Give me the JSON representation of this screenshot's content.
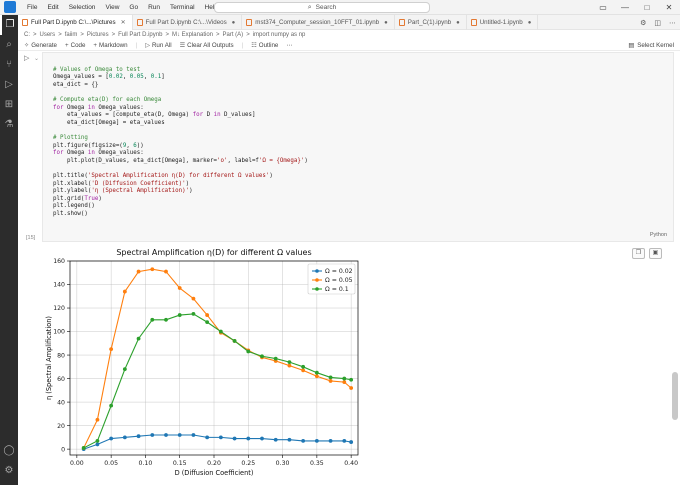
{
  "menu": [
    "File",
    "Edit",
    "Selection",
    "View",
    "Go",
    "Run",
    "Terminal",
    "Help"
  ],
  "search": {
    "placeholder": "Search"
  },
  "tabs": [
    {
      "label": "Full Part D.ipynb  C:\\...\\Pictures",
      "active": true
    },
    {
      "label": "Full Part D.ipynb  C:\\...\\Videos",
      "active": false
    },
    {
      "label": "mst374_Computer_session_10FFT_01.ipynb",
      "active": false
    },
    {
      "label": "Part_C(1).ipynb",
      "active": false
    },
    {
      "label": "Untitled-1.ipynb",
      "active": false
    }
  ],
  "breadcrumb": [
    "C:",
    ">",
    "Users",
    ">",
    "faiim",
    ">",
    "Pictures",
    ">",
    "Full Part D.ipynb",
    ">",
    "M↓ Explanation",
    ">",
    "Part (A)",
    ">",
    "import numpy as np"
  ],
  "toolbar": {
    "generate": "Generate",
    "code": "Code",
    "markdown": "Markdown",
    "run_all": "Run All",
    "clear_outputs": "Clear All Outputs",
    "outline": "Outline",
    "kernel": "Select Kernel"
  },
  "cell": {
    "run_icon": "play-icon",
    "language": "Python",
    "exec_count": "[15]",
    "lines": [
      [
        [
          "",
          "    "
        ]
      ],
      [
        [
          "c-com",
          "# Values of Omega to test"
        ]
      ],
      [
        [
          "",
          "Omega_values = ["
        ],
        [
          "c-num",
          "0.02"
        ],
        [
          "",
          ", "
        ],
        [
          "c-num",
          "0.05"
        ],
        [
          "",
          ", "
        ],
        [
          "c-num",
          "0.1"
        ],
        [
          "",
          "]"
        ]
      ],
      [
        [
          "",
          "eta_dict = {}"
        ]
      ],
      [
        [
          "",
          ""
        ]
      ],
      [
        [
          "c-com",
          "# Compute eta(D) for each Omega"
        ]
      ],
      [
        [
          "c-kw",
          "for"
        ],
        [
          "",
          " Omega "
        ],
        [
          "c-kw",
          "in"
        ],
        [
          "",
          " Omega_values:"
        ]
      ],
      [
        [
          "",
          "    eta_values = [compute_eta(D, Omega) "
        ],
        [
          "c-kw",
          "for"
        ],
        [
          "",
          " D "
        ],
        [
          "c-kw",
          "in"
        ],
        [
          "",
          " D_values]"
        ]
      ],
      [
        [
          "",
          "    eta_dict[Omega] = eta_values"
        ]
      ],
      [
        [
          "",
          ""
        ]
      ],
      [
        [
          "c-com",
          "# Plotting"
        ]
      ],
      [
        [
          "",
          "plt.figure(figsize=("
        ],
        [
          "c-num",
          "9"
        ],
        [
          "",
          ", "
        ],
        [
          "c-num",
          "6"
        ],
        [
          "",
          "))"
        ]
      ],
      [
        [
          "c-kw",
          "for"
        ],
        [
          "",
          " Omega "
        ],
        [
          "c-kw",
          "in"
        ],
        [
          "",
          " Omega_values:"
        ]
      ],
      [
        [
          "",
          "    plt.plot(D_values, eta_dict[Omega], marker="
        ],
        [
          "c-str",
          "'o'"
        ],
        [
          "",
          ", label=f"
        ],
        [
          "c-str",
          "'Ω = {Omega}'"
        ],
        [
          "",
          ")"
        ]
      ],
      [
        [
          "",
          ""
        ]
      ],
      [
        [
          "",
          "plt.title("
        ],
        [
          "c-str",
          "'Spectral Amplification η(D) for different Ω values'"
        ],
        [
          "",
          ")"
        ]
      ],
      [
        [
          "",
          "plt.xlabel("
        ],
        [
          "c-str",
          "'D (Diffusion Coefficient)'"
        ],
        [
          "",
          ")"
        ]
      ],
      [
        [
          "",
          "plt.ylabel("
        ],
        [
          "c-str",
          "'η (Spectral Amplification)'"
        ],
        [
          "",
          ")"
        ]
      ],
      [
        [
          "",
          "plt.grid("
        ],
        [
          "c-kw",
          "True"
        ],
        [
          "",
          ")"
        ]
      ],
      [
        [
          "",
          "plt.legend()"
        ]
      ],
      [
        [
          "",
          "plt.show()"
        ]
      ]
    ]
  },
  "colors": {
    "blue": "#1f77b4",
    "orange": "#ff7f0e",
    "green": "#2ca02c",
    "activity_bg": "#2c2c2c"
  },
  "chart_data": {
    "type": "line",
    "title": "Spectral Amplification η(D) for different Ω values",
    "xlabel": "D (Diffusion Coefficient)",
    "ylabel": "η (Spectral Amplification)",
    "xlim": [
      -0.01,
      0.41
    ],
    "ylim": [
      -5,
      160
    ],
    "xticks": [
      "0.00",
      "0.05",
      "0.10",
      "0.15",
      "0.20",
      "0.25",
      "0.30",
      "0.35",
      "0.40"
    ],
    "yticks": [
      "0",
      "20",
      "40",
      "60",
      "80",
      "100",
      "120",
      "140",
      "160"
    ],
    "grid": true,
    "legend_position": "top-right",
    "x": [
      0.01,
      0.03,
      0.05,
      0.07,
      0.09,
      0.11,
      0.13,
      0.15,
      0.17,
      0.19,
      0.21,
      0.23,
      0.25,
      0.27,
      0.29,
      0.31,
      0.33,
      0.35,
      0.37,
      0.39,
      0.4
    ],
    "series": [
      {
        "name": "Ω = 0.02",
        "color": "#1f77b4",
        "values": [
          0,
          4,
          9,
          10,
          11,
          12,
          12,
          12,
          12,
          10,
          10,
          9,
          9,
          9,
          8,
          8,
          7,
          7,
          7,
          7,
          6
        ]
      },
      {
        "name": "Ω = 0.05",
        "color": "#ff7f0e",
        "values": [
          1,
          25,
          85,
          134,
          151,
          153,
          151,
          137,
          128,
          114,
          99,
          92,
          84,
          78,
          75,
          71,
          67,
          62,
          58,
          57,
          52
        ]
      },
      {
        "name": "Ω = 0.1",
        "color": "#2ca02c",
        "values": [
          1,
          7,
          37,
          68,
          94,
          110,
          110,
          114,
          115,
          108,
          100,
          92,
          83,
          79,
          77,
          74,
          70,
          65,
          61,
          60,
          59
        ]
      }
    ]
  }
}
